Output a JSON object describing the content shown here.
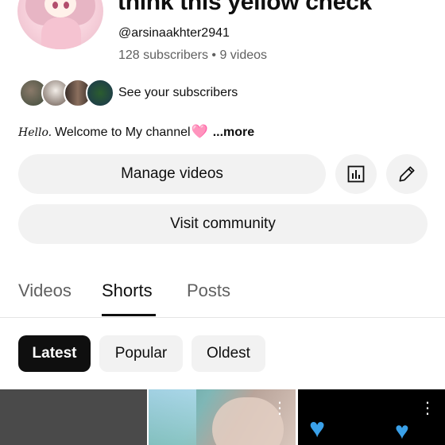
{
  "channel": {
    "title": "think this yellow check",
    "handle": "@arsinaakhter2941",
    "stats": "128 subscribers • 9 videos",
    "see_subscribers": "See your subscribers",
    "description_prefix": "Hello.",
    "description": "Welcome to My channel",
    "description_emoji": "🩷",
    "more": "...more"
  },
  "actions": {
    "manage_videos": "Manage videos",
    "visit_community": "Visit community",
    "analytics_icon": "bar-chart-icon",
    "edit_icon": "pencil-icon"
  },
  "tabs": [
    {
      "label": "Videos",
      "selected": false
    },
    {
      "label": "Shorts",
      "selected": true
    },
    {
      "label": "Posts",
      "selected": false
    }
  ],
  "filters": [
    {
      "label": "Latest",
      "selected": true
    },
    {
      "label": "Popular",
      "selected": false
    },
    {
      "label": "Oldest",
      "selected": false
    }
  ],
  "colors": {
    "background": "#ffffff",
    "chip_bg": "#f2f2f2",
    "selected_chip": "#0f0f0f",
    "secondary_text": "#606060",
    "heart_pink": "#ff7ab8",
    "heart_blue": "#3aa0e8"
  }
}
